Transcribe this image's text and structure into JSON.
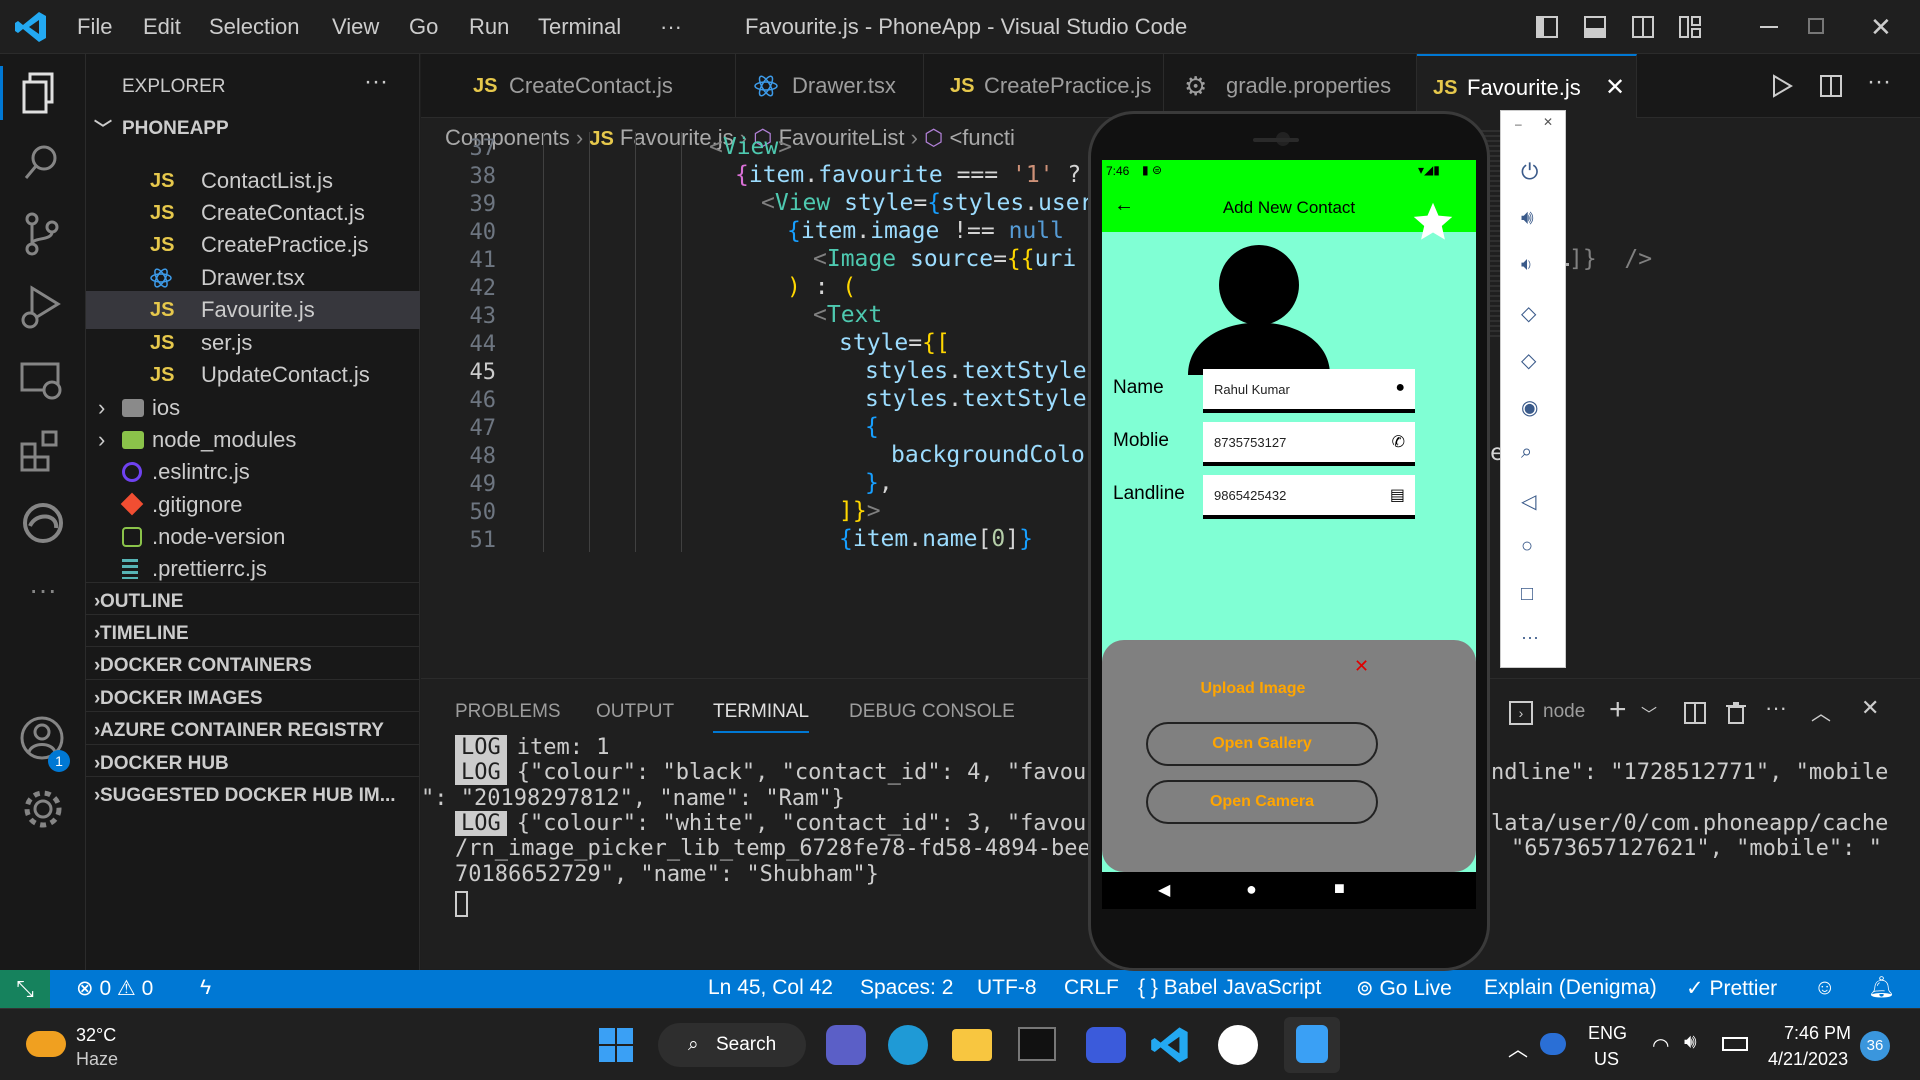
{
  "window": {
    "title": "Favourite.js - PhoneApp - Visual Studio Code",
    "menu": [
      "File",
      "Edit",
      "Selection",
      "View",
      "Go",
      "Run",
      "Terminal",
      "···"
    ]
  },
  "explorer": {
    "header": "EXPLORER",
    "more": "···",
    "project": "PHONEAPP",
    "files": [
      {
        "name": "ContactList.js",
        "icon": "JS"
      },
      {
        "name": "CreateContact.js",
        "icon": "JS"
      },
      {
        "name": "CreatePractice.js",
        "icon": "JS"
      },
      {
        "name": "Drawer.tsx",
        "icon": "react-icon"
      },
      {
        "name": "Favourite.js",
        "icon": "JS"
      },
      {
        "name": "ser.js",
        "icon": "JS"
      },
      {
        "name": "UpdateContact.js",
        "icon": "JS"
      },
      {
        "name": "ios",
        "icon": "folder-apple-icon"
      },
      {
        "name": "node_modules",
        "icon": "folder-node-icon"
      },
      {
        "name": ".eslintrc.js",
        "icon": "eslint-icon"
      },
      {
        "name": ".gitignore",
        "icon": "git-icon"
      },
      {
        "name": ".node-version",
        "icon": "node-icon"
      },
      {
        "name": ".prettierrc.js",
        "icon": "prettier-icon"
      }
    ],
    "sections": [
      "OUTLINE",
      "TIMELINE",
      "DOCKER CONTAINERS",
      "DOCKER IMAGES",
      "AZURE CONTAINER REGISTRY",
      "DOCKER HUB",
      "SUGGESTED DOCKER HUB IM..."
    ]
  },
  "tabs": [
    {
      "label": "CreateContact.js",
      "icon": "JS"
    },
    {
      "label": "Drawer.tsx",
      "icon": "react-icon"
    },
    {
      "label": "CreatePractice.js",
      "icon": "JS"
    },
    {
      "label": "gradle.properties",
      "icon": "gear-icon"
    },
    {
      "label": "Favourite.js",
      "icon": "JS",
      "active": true
    }
  ],
  "breadcrumb": [
    "Components",
    "Favourite.js",
    "FavouriteList",
    "<functi"
  ],
  "editor": {
    "line_numbers": [
      "37",
      "38",
      "39",
      "40",
      "41",
      "42",
      "43",
      "44",
      "45",
      "46",
      "47",
      "48",
      "49",
      "50",
      "51"
    ],
    "right_fragments": [
      "]}  />",
      "e"
    ]
  },
  "panel": {
    "tabs": [
      "PROBLEMS",
      "OUTPUT",
      "TERMINAL",
      "DEBUG CONSOLE"
    ],
    "active_tab": "TERMINAL",
    "terminal_name": "node",
    "log_badge": "LOG",
    "lines": {
      "l1": "item: 1",
      "l2a": "{\"colour\": \"black\", \"contact_id\": 4, \"favou",
      "l2b": "ndline\": \"1728512771\", \"mobile",
      "l3": "\": \"20198297812\", \"name\": \"Ram\"}",
      "l4a": "{\"colour\": \"white\", \"contact_id\": 3, \"favou",
      "l4b": "lata/user/0/com.phoneapp/cache",
      "l5a": "/rn_image_picker_lib_temp_6728fe78-fd58-4894-bee2",
      "l5b": "\"6573657127621\", \"mobile\": \"",
      "l6": "70186652729\", \"name\": \"Shubham\"}"
    }
  },
  "status": {
    "errors": "0",
    "warnings": "0",
    "position": "Ln 45, Col 42",
    "spaces": "Spaces: 2",
    "encoding": "UTF-8",
    "eol": "CRLF",
    "language": "Babel JavaScript",
    "golive": "Go Live",
    "explain": "Explain (Denigma)",
    "prettier": "Prettier"
  },
  "phone": {
    "status_time": "7:46",
    "app_title": "Add New Contact",
    "fields": [
      {
        "label": "Name",
        "value": "Rahul Kumar",
        "icon": "person-icon"
      },
      {
        "label": "Moblie",
        "value": "8735753127",
        "icon": "phone-icon"
      },
      {
        "label": "Landline",
        "value": "9865425432",
        "icon": "fax-icon"
      }
    ],
    "sheet": {
      "title": "Upload Image",
      "close": "✕",
      "gallery": "Open Gallery",
      "camera": "Open Camera"
    }
  },
  "taskbar": {
    "temperature": "32°C",
    "weather": "Haze",
    "search": "Search",
    "lang1": "ENG",
    "lang2": "US",
    "time": "7:46 PM",
    "date": "4/21/2023",
    "notifications": "36",
    "account_badge": "1"
  },
  "colors": {
    "accent": "#0078d4",
    "app_bar": "#00ff00",
    "app_bg": "#80ffd4",
    "sheet_btn_text": "#ffa500"
  }
}
